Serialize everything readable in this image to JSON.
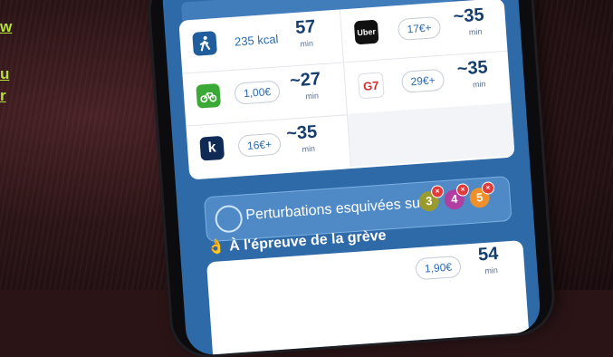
{
  "photo_overlay": {
    "left_lines": [
      "w",
      "u",
      "r"
    ],
    "accent_color": "#b9e23a"
  },
  "app": {
    "options": [
      {
        "id": "walk",
        "icon": "walking-person-icon",
        "detail": "235 kcal",
        "time": "57",
        "unit": "min"
      },
      {
        "id": "uber",
        "icon": "uber-logo",
        "logo_text": "Uber",
        "price": "17€+",
        "time": "~35",
        "unit": "min"
      },
      {
        "id": "bike",
        "icon": "velib-bike-icon",
        "price": "1,00€",
        "time": "~27",
        "unit": "min"
      },
      {
        "id": "g7",
        "icon": "g7-logo",
        "logo_text": "G7",
        "price": "29€+",
        "time": "~35",
        "unit": "min"
      },
      {
        "id": "kapten",
        "icon": "kapten-logo",
        "logo_text": "k",
        "price": "16€+",
        "time": "~35",
        "unit": "min"
      }
    ],
    "banner": {
      "text": "Perturbations esquivées sur",
      "lines": [
        {
          "label": "3",
          "color": "#9a9a2e"
        },
        {
          "label": "4",
          "color": "#b13fa1"
        },
        {
          "label": "5",
          "color": "#f0902a"
        }
      ]
    },
    "section_heading": "À l'épreuve de la grève",
    "bottom_row": {
      "price": "1,90€",
      "time": "54",
      "unit": "min"
    }
  }
}
